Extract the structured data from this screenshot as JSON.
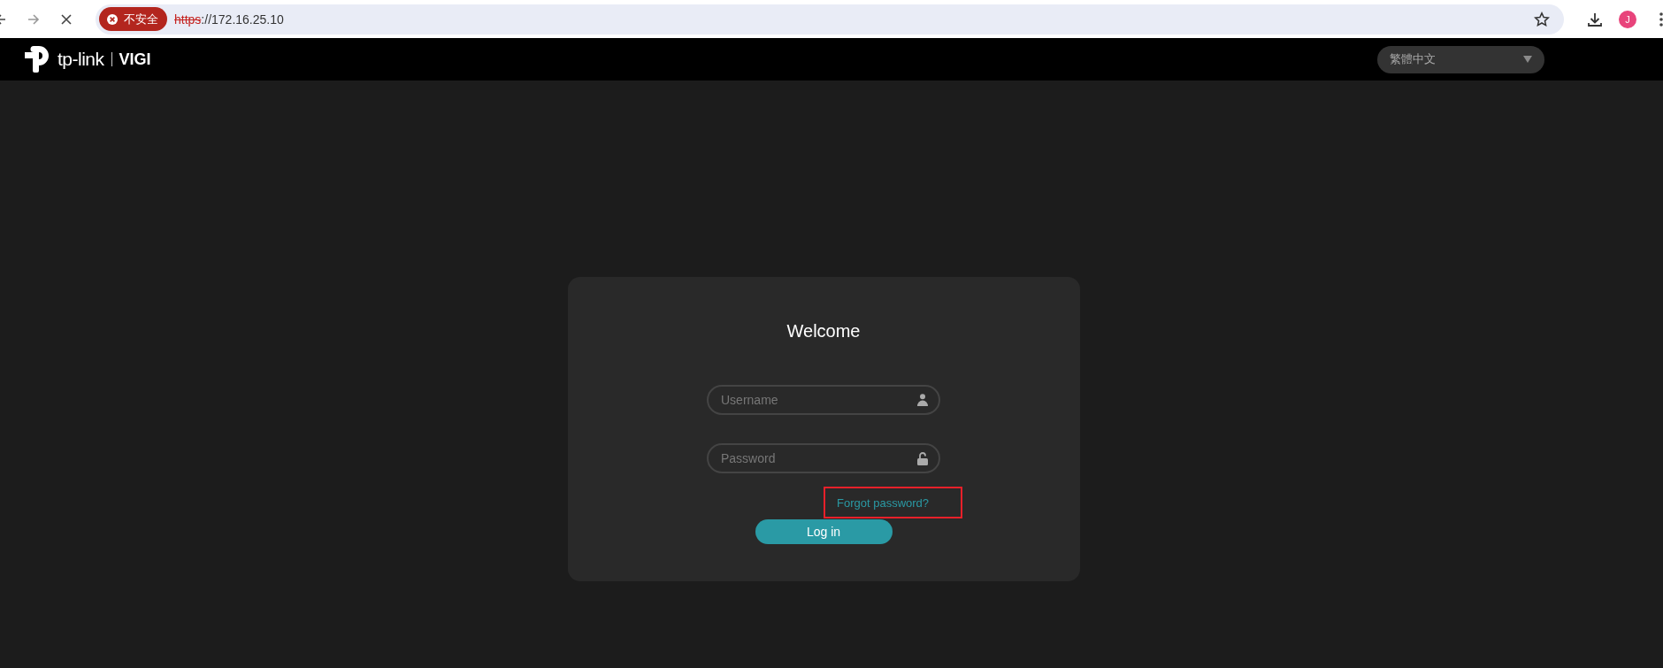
{
  "browser": {
    "security_chip": "不安全",
    "url_scheme": "https",
    "url_rest": "://172.16.25.10",
    "profile_initial": "J"
  },
  "header": {
    "brand": "tp-link",
    "product": "VIGI",
    "language": "繁體中文"
  },
  "login": {
    "title": "Welcome",
    "fields": [
      {
        "kind": "user",
        "placeholder": "Username"
      },
      {
        "kind": "lock",
        "placeholder": "Password"
      }
    ],
    "forgot_link": "Forgot password?",
    "forgot_highlighted": true,
    "button": "Log in"
  }
}
